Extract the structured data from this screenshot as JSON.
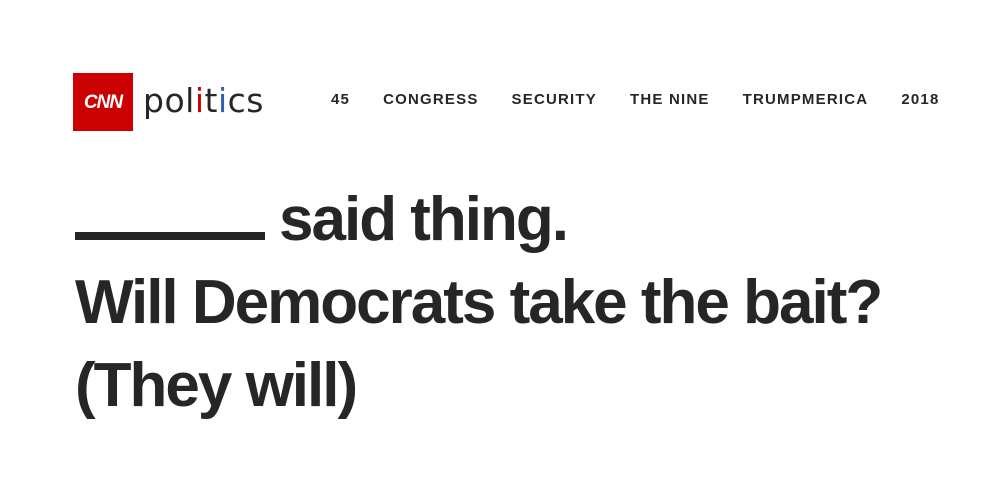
{
  "brand": {
    "logo_text": "CNN",
    "section_prefix": "pol",
    "section_i1": "i",
    "section_mid": "t",
    "section_i2": "i",
    "section_suffix": "cs",
    "logo_color": "#cc0000"
  },
  "nav": {
    "items": [
      "45",
      "CONGRESS",
      "SECURITY",
      "THE NINE",
      "TRUMPMERICA",
      "2018"
    ]
  },
  "headline": {
    "line1_rest": "said thing.",
    "line2": "Will Democrats take the bait?",
    "line3": "(They will)"
  }
}
